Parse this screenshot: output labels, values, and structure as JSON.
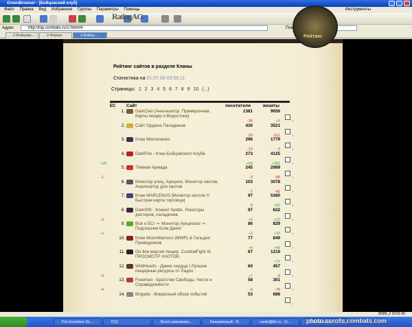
{
  "window": {
    "title": "GreenBrowser - [Бойцовский клуб]"
  },
  "menu": [
    "Файл",
    "Правка",
    "Вид",
    "Избранное",
    "Группы",
    "Параметры",
    "Помощь"
  ],
  "menu_tools": "Инструменты",
  "address": {
    "label": "Адрес",
    "value": "http://top.combats.ru/1.html#4",
    "search_label": "Поиск",
    "search_value": "лык"
  },
  "tabs": [
    "2-Бойцове...",
    "2-Форум",
    "2-Бойцо..."
  ],
  "page": {
    "logo": "RatingAG",
    "emblem": "Рейтинг",
    "heading_prefix": "Рейтинг сайтов в разделе",
    "heading_section": "Кланы",
    "stats_label": "Статистика на",
    "stats_date": "01.07.08 09:59:11",
    "pages_label": "Страницы:",
    "pages": [
      "1",
      "2",
      "3",
      "4",
      "5",
      "6",
      "7",
      "8",
      "9",
      "10",
      "(...)"
    ],
    "col_site": "Сайт",
    "col_visitors": "посетители",
    "col_visits": "визиты",
    "col_ec": "ЕС"
  },
  "rows": [
    {
      "num": "1.",
      "name": "DarkClan [Анализатор, Примерочная, Карты пещер и Водостока]",
      "vis": "1381",
      "vz": "9056",
      "d1": "-36",
      "d2": "+3",
      "c": "#7a5a3a"
    },
    {
      "num": "2.",
      "name": "Сайт Ордена Паладинов",
      "vis": "430",
      "vz": "3521",
      "d1": "-20",
      "d2": "-311",
      "c": "#d4b030"
    },
    {
      "num": "3.",
      "name": "Клан Mercenaries",
      "vis": "296",
      "vz": "1779",
      "d1": "-13",
      "d2": "-3",
      "c": "#335"
    },
    {
      "num": "4.",
      "name": "DarkFire - Клан Бойцовского Клуба",
      "vis": "273",
      "vz": "4125",
      "d1": "+56",
      "d2": "+381",
      "lft": "+25",
      "c": "#b22"
    },
    {
      "num": "5.",
      "name": "Тёмная Армада",
      "vis": "245",
      "vz": "2689",
      "d1": "-9",
      "d2": "-86",
      "lft": "-1",
      "c": "#c33"
    },
    {
      "num": "6.",
      "name": "Монитор улиц, Аукцион, Монитор хаотов, Анализатор для хаотов",
      "vis": "103",
      "vz": "3078",
      "d1": "-7",
      "d2": "-42",
      "c": "#556"
    },
    {
      "num": "7.",
      "name": "Клан MARLENUS [Монитор хаотов !!! Быстрая карта торговца]",
      "vis": "97",
      "vz": "5360",
      "d1": "-5",
      "d2": "+63",
      "c": "#447"
    },
    {
      "num": "8.",
      "name": "DarkSIN - Клиент fastbk. Локаторы докторов, паладинов.",
      "vis": "97",
      "vz": "622",
      "d1": "+4",
      "d2": "+22",
      "lft": "-3",
      "c": "#424"
    },
    {
      "num": "9.",
      "name": "Всё о БС! -•- Монитор Аукциона! -•- Подсказчик Блэк Джек!",
      "vis": "86",
      "vz": "829",
      "d1": "+3",
      "d2": "+32",
      "lft": "+1",
      "c": "#5a2"
    },
    {
      "num": "10.",
      "name": "Клан MoonWarriors (MWR) & Гильдия Проводников",
      "vis": "77",
      "vz": "849",
      "d1": "+4",
      "d2": "+49",
      "c": "#822"
    },
    {
      "num": "11.",
      "name": "On-line версия пещер. CombatFight III. ПРОСМОТР ХАОТОВ.",
      "vis": "67",
      "vz": "1216",
      "d1": "",
      "d2": "+72",
      "c": "#222"
    },
    {
      "num": "12.",
      "name": "WildHearts - Дикие сердца | Лучшие пещерные ресурсы от Ладох",
      "vis": "60",
      "vz": "457",
      "d1": "+7",
      "d2": "-9",
      "lft": "-4",
      "c": "#633"
    },
    {
      "num": "13.",
      "name": "Freemen - Братство Свободы, Чести и Справедливости",
      "vis": "58",
      "vz": "301",
      "d1": "-6",
      "d2": "-70",
      "lft": "-4",
      "c": "#a44"
    },
    {
      "num": "14.",
      "name": "Brigada - Вокресный обзор событий",
      "vis": "53",
      "vz": "688",
      "d1": "",
      "d2": "",
      "c": "#888"
    }
  ],
  "status": "859M_2 10:01:06",
  "taskbar": [
    "Pro Evolution So...",
    "ICQ",
    "Всего разговоро...",
    "Безымянный - В...",
    "cantri@bk.ru - О...",
    "GreenBrowser"
  ],
  "watermark": "photo.scrolls.combats.com"
}
